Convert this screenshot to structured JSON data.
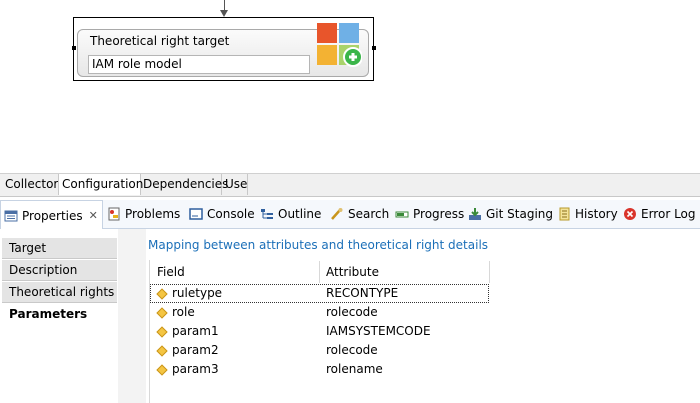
{
  "diagram": {
    "node_title": "Theoretical right target",
    "node_subtitle": "IAM role model",
    "node_icon": "windows-add-icon"
  },
  "top_tabs": [
    "Collector",
    "Configuration",
    "Dependencies",
    "Use"
  ],
  "view_tabs": [
    {
      "label": "Properties",
      "icon": "properties-icon"
    },
    {
      "label": "Problems",
      "icon": "problems-icon"
    },
    {
      "label": "Console",
      "icon": "console-icon"
    },
    {
      "label": "Outline",
      "icon": "outline-icon"
    },
    {
      "label": "Search",
      "icon": "search-icon"
    },
    {
      "label": "Progress",
      "icon": "progress-icon"
    },
    {
      "label": "Git Staging",
      "icon": "git-staging-icon"
    },
    {
      "label": "History",
      "icon": "history-icon"
    },
    {
      "label": "Error Log",
      "icon": "error-log-icon"
    }
  ],
  "sidebar": {
    "items": [
      "Target",
      "Description",
      "Theoretical rights",
      "Parameters"
    ],
    "active": "Parameters"
  },
  "main": {
    "heading": "Mapping between attributes and theoretical right details",
    "columns": [
      "Field",
      "Attribute"
    ],
    "rows": [
      {
        "field": "ruletype",
        "attribute": "RECONTYPE"
      },
      {
        "field": "role",
        "attribute": "rolecode"
      },
      {
        "field": "param1",
        "attribute": "IAMSYSTEMCODE"
      },
      {
        "field": "param2",
        "attribute": "rolecode"
      },
      {
        "field": "param3",
        "attribute": "rolename"
      }
    ]
  },
  "colors": {
    "accent": "#1b6fb8",
    "diamond": "#f4c542"
  }
}
